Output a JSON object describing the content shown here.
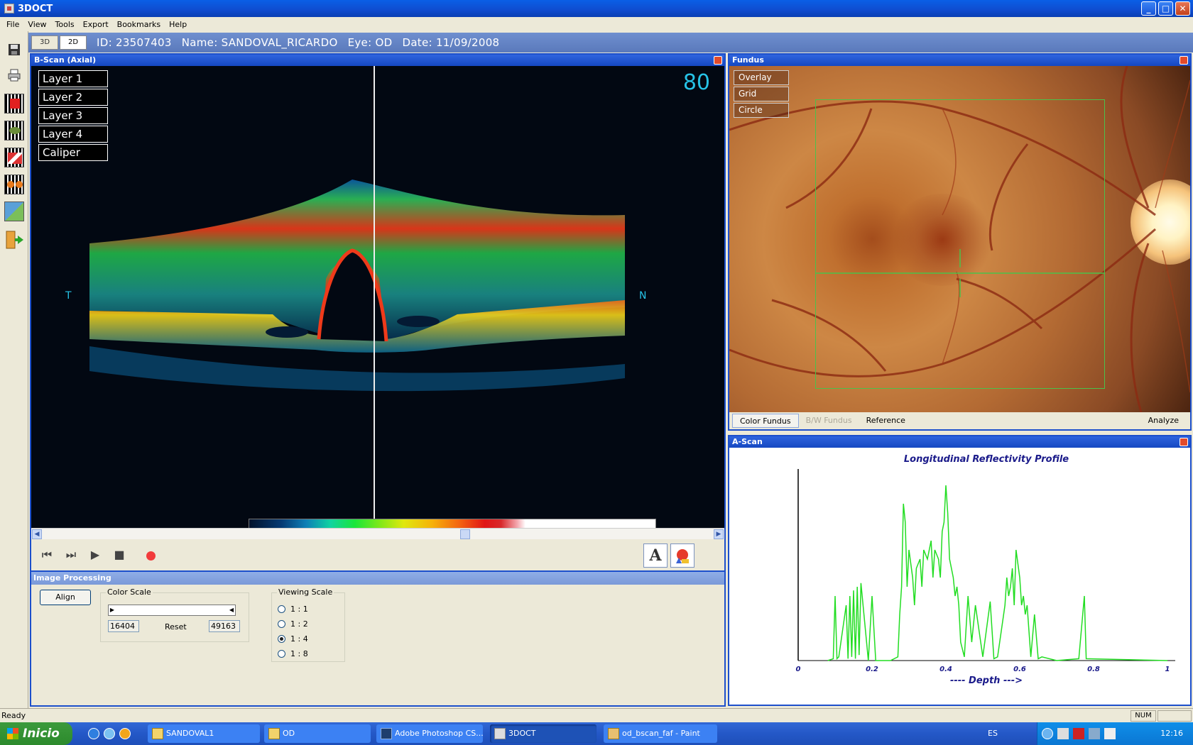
{
  "window": {
    "title": "3DOCT"
  },
  "menu": [
    "File",
    "View",
    "Tools",
    "Export",
    "Bookmarks",
    "Help"
  ],
  "view_tabs": [
    "3D",
    "2D"
  ],
  "patient": {
    "id": "ID: 23507403",
    "name": "Name: SANDOVAL_RICARDO",
    "eye": "Eye: OD",
    "date": "Date: 11/09/2008"
  },
  "bscan": {
    "title": "B-Scan (Axial)",
    "layers": [
      "Layer 1",
      "Layer 2",
      "Layer 3",
      "Layer 4",
      "Caliper"
    ],
    "frame": "80",
    "left_label": "T",
    "right_label": "N",
    "text_tool": "A"
  },
  "image_processing": {
    "title": "Image Processing",
    "align": "Align",
    "color_scale": {
      "legend": "Color Scale",
      "min": "16404",
      "max": "49163",
      "reset": "Reset"
    },
    "viewing_scale": {
      "legend": "Viewing Scale",
      "options": [
        "1 : 1",
        "1 : 2",
        "1 : 4",
        "1 : 8"
      ],
      "selected": "1 : 4"
    }
  },
  "fundus": {
    "title": "Fundus",
    "overlay_buttons": [
      "Overlay",
      "Grid",
      "Circle"
    ],
    "tabs": [
      "Color Fundus",
      "B/W Fundus",
      "Reference"
    ],
    "analyze": "Analyze"
  },
  "ascan": {
    "title": "A-Scan"
  },
  "chart_data": {
    "type": "line",
    "title": "Longitudinal Reflectivity Profile",
    "xlabel": "---- Depth --->",
    "ylabel": "",
    "xlim": [
      0,
      1
    ],
    "ylim": [
      0,
      1
    ],
    "xticks": [
      "0",
      "0.2",
      "0.4",
      "0.6",
      "0.8",
      "1"
    ],
    "color": "#22dd22",
    "x": [
      0.08,
      0.095,
      0.1,
      0.105,
      0.11,
      0.13,
      0.135,
      0.14,
      0.145,
      0.15,
      0.155,
      0.16,
      0.165,
      0.17,
      0.19,
      0.2,
      0.21,
      0.25,
      0.27,
      0.275,
      0.28,
      0.285,
      0.29,
      0.295,
      0.3,
      0.31,
      0.315,
      0.32,
      0.33,
      0.335,
      0.34,
      0.35,
      0.36,
      0.365,
      0.37,
      0.38,
      0.385,
      0.39,
      0.395,
      0.4,
      0.405,
      0.41,
      0.415,
      0.42,
      0.425,
      0.43,
      0.435,
      0.44,
      0.45,
      0.46,
      0.47,
      0.48,
      0.5,
      0.52,
      0.53,
      0.54,
      0.56,
      0.565,
      0.57,
      0.575,
      0.58,
      0.585,
      0.59,
      0.6,
      0.605,
      0.61,
      0.615,
      0.62,
      0.63,
      0.64,
      0.65,
      0.66,
      0.7,
      0.76,
      0.775,
      0.78,
      1.0
    ],
    "y": [
      0,
      0.01,
      0.35,
      0.01,
      0.02,
      0.3,
      0.01,
      0.35,
      0.02,
      0.38,
      0.01,
      0.4,
      0.03,
      0.42,
      0.0,
      0.35,
      0.0,
      0.0,
      0.02,
      0.25,
      0.4,
      0.85,
      0.75,
      0.4,
      0.6,
      0.45,
      0.3,
      0.5,
      0.55,
      0.4,
      0.6,
      0.55,
      0.65,
      0.45,
      0.6,
      0.55,
      0.45,
      0.7,
      0.75,
      0.95,
      0.8,
      0.55,
      0.5,
      0.45,
      0.35,
      0.4,
      0.3,
      0.1,
      0.02,
      0.35,
      0.1,
      0.3,
      0.02,
      0.32,
      0.01,
      0.02,
      0.3,
      0.45,
      0.35,
      0.4,
      0.5,
      0.3,
      0.6,
      0.45,
      0.3,
      0.35,
      0.25,
      0.3,
      0.02,
      0.25,
      0.01,
      0.02,
      0.0,
      0.01,
      0.35,
      0.01,
      0.0
    ]
  },
  "status": {
    "text": "Ready",
    "num": "NUM"
  },
  "taskbar": {
    "start": "Inicio",
    "tasks": [
      "SANDOVAL1",
      "OD",
      "Adobe Photoshop CS...",
      "3DOCT",
      "od_bscan_faf - Paint"
    ],
    "lang": "ES",
    "clock": "12:16"
  }
}
